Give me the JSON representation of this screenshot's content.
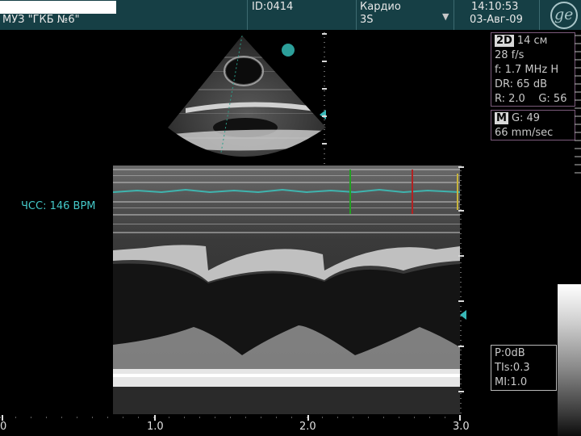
{
  "header": {
    "facility": "МУЗ \"ГКБ №6\"",
    "patient_id": "ID:0414",
    "preset": "Кардио",
    "probe": "3S",
    "time": "14:10:53",
    "date": "03-Авг-09",
    "logo_icon": "ge-logo-icon",
    "dropdown_icon": "chevron-down-icon"
  },
  "panel_2d": {
    "mode": "2D",
    "depth": "14 см",
    "frame_rate": "28 f/s",
    "frequency": "f: 1.7 MHz H",
    "dynamic_range": "DR: 65 dB",
    "r_g": "R: 2.0    G: 56"
  },
  "panel_m": {
    "mode": "M",
    "gain": "G: 49",
    "sweep_speed": "66 mm/sec"
  },
  "panel_power": {
    "power": "P:0dB",
    "tis": "TIs:0.3",
    "mi": "MI:1.0"
  },
  "heart_rate": "ЧСС: 146 BPM",
  "time_axis": [
    "0",
    "1.0",
    "2.0",
    "3.0"
  ],
  "colors": {
    "header_bg": "#163f45",
    "ecg_trace": "#3fb4ae",
    "hr_text": "#44c8c8",
    "caliper_green": "#22a022",
    "caliper_red": "#b22222",
    "caliper_yellow": "#c8b43c",
    "panel_border": "#7b5a7b"
  }
}
